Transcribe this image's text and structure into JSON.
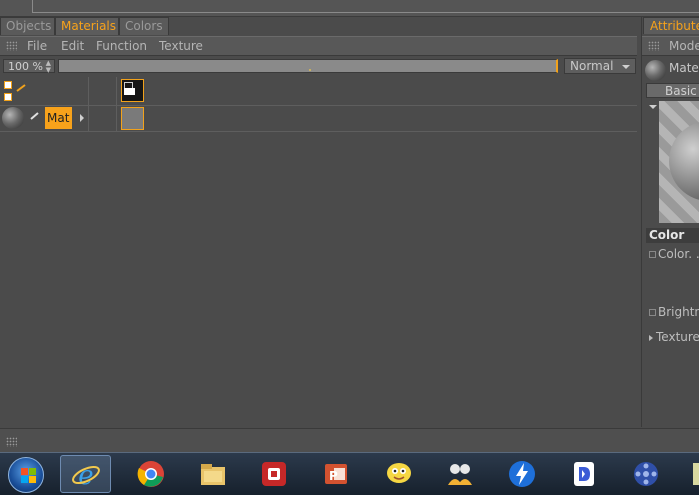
{
  "left_panel": {
    "tabs": [
      {
        "label": "Objects",
        "active": false
      },
      {
        "label": "Materials",
        "active": true
      },
      {
        "label": "Colors",
        "active": false
      }
    ],
    "menu": [
      "File",
      "Edit",
      "Function",
      "Texture"
    ],
    "toolbar": {
      "zoom": "100 %",
      "mode": "Normal"
    },
    "materials": [
      {
        "name": "Mat"
      }
    ]
  },
  "right_panel": {
    "tab_label": "Attributes",
    "menu_label": "Mode",
    "material_label": "Mate",
    "page_tab": "Basic",
    "section": "Color",
    "rows": [
      {
        "label": "Color. . ."
      },
      {
        "label": "Brightne"
      },
      {
        "label": "Texture"
      }
    ]
  },
  "taskbar": {
    "apps": [
      "start",
      "internet-explorer",
      "chrome",
      "file-explorer",
      "app-red",
      "powerpoint",
      "messenger",
      "app-people",
      "app-bolt",
      "app-d",
      "app-film",
      "app-partial"
    ]
  },
  "colors": {
    "accent": "#f7a21b",
    "panel_bg": "#4b4b4b"
  }
}
